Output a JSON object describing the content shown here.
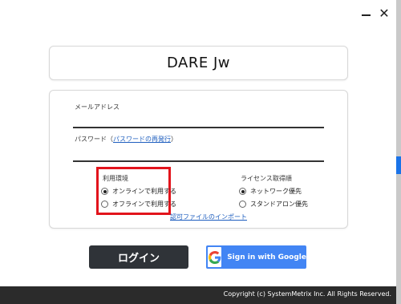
{
  "window": {
    "minimize_glyph": "—",
    "close_glyph": "✕"
  },
  "header": {
    "title": "DARE Jw"
  },
  "form": {
    "email_label": "メールアドレス",
    "email_value": "",
    "password_label_prefix": "パスワード（",
    "password_reset_link": "パスワードの再発行",
    "password_label_suffix": "）",
    "password_value": ""
  },
  "environment": {
    "title": "利用環境",
    "options": [
      {
        "label": "オンラインで利用する",
        "selected": true
      },
      {
        "label": "オフラインで利用する",
        "selected": false
      }
    ],
    "highlight_color": "#e2141c"
  },
  "license": {
    "title": "ライセンス取得順",
    "options": [
      {
        "label": "ネットワーク優先",
        "selected": true
      },
      {
        "label": "スタンドアロン優先",
        "selected": false
      }
    ]
  },
  "import_link": "認可ファイルのインポート",
  "buttons": {
    "login": "ログイン",
    "google": "Sign in with Google",
    "google_color": "#4285f4",
    "login_color": "#2f3338"
  },
  "footer": {
    "copyright": "Copyright (c) SystemMetrix Inc. All Rights Reserved."
  }
}
